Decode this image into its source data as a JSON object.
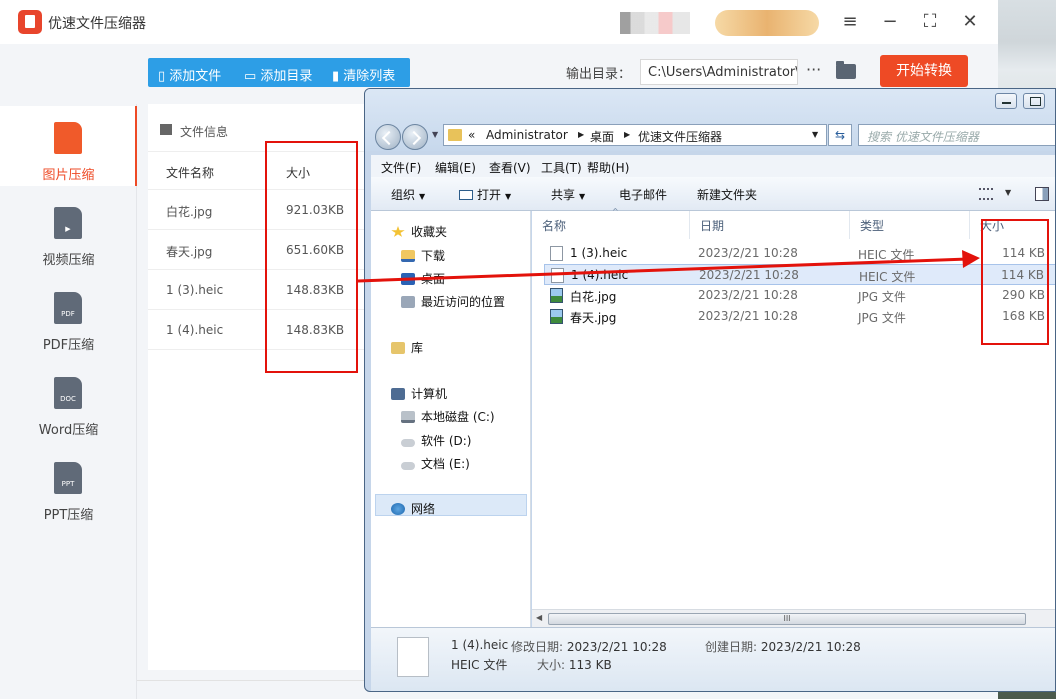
{
  "app": {
    "title": "优速文件压缩器",
    "toolbar": {
      "add_file": "添加文件",
      "add_dir": "添加目录",
      "clear_list": "清除列表"
    },
    "output": {
      "label": "输出目录：",
      "path": "C:\\Users\\Administrator\\",
      "more": "···",
      "start": "开始转换"
    },
    "sidebar": [
      {
        "label": "图片压缩",
        "icon": "image-file-icon",
        "badge": "",
        "active": true
      },
      {
        "label": "视频压缩",
        "icon": "video-file-icon",
        "badge": "▶",
        "active": false
      },
      {
        "label": "PDF压缩",
        "icon": "pdf-file-icon",
        "badge": "PDF",
        "active": false
      },
      {
        "label": "Word压缩",
        "icon": "doc-file-icon",
        "badge": "DOC",
        "active": false
      },
      {
        "label": "PPT压缩",
        "icon": "ppt-file-icon",
        "badge": "PPT",
        "active": false
      }
    ],
    "panel": {
      "title": "文件信息",
      "col_name": "文件名称",
      "col_size": "大小",
      "rows": [
        {
          "name": "白花.jpg",
          "size": "921.03KB"
        },
        {
          "name": "春天.jpg",
          "size": "651.60KB"
        },
        {
          "name": "1 (3).heic",
          "size": "148.83KB"
        },
        {
          "name": "1 (4).heic",
          "size": "148.83KB"
        }
      ]
    }
  },
  "explorer": {
    "address": {
      "prefix": "«",
      "parts": [
        "Administrator",
        "桌面",
        "优速文件压缩器"
      ]
    },
    "search_placeholder": "搜索 优速文件压缩器",
    "menu": [
      "文件(F)",
      "编辑(E)",
      "查看(V)",
      "工具(T)",
      "帮助(H)"
    ],
    "commands": {
      "organize": "组织",
      "open": "打开",
      "share": "共享",
      "email": "电子邮件",
      "new_folder": "新建文件夹"
    },
    "nav": {
      "favorites": "收藏夹",
      "downloads": "下载",
      "desktop": "桌面",
      "recent": "最近访问的位置",
      "libraries": "库",
      "computer": "计算机",
      "drive_c": "本地磁盘 (C:)",
      "drive_d": "软件 (D:)",
      "drive_e": "文档 (E:)",
      "network": "网络"
    },
    "columns": {
      "name": "名称",
      "date": "日期",
      "type": "类型",
      "size": "大小"
    },
    "files": [
      {
        "name": "1 (3).heic",
        "date": "2023/2/21 10:28",
        "type": "HEIC 文件",
        "size": "114 KB",
        "icon": "blank-file-icon"
      },
      {
        "name": "1 (4).heic",
        "date": "2023/2/21 10:28",
        "type": "HEIC 文件",
        "size": "114 KB",
        "icon": "blank-file-icon"
      },
      {
        "name": "白花.jpg",
        "date": "2023/2/21 10:28",
        "type": "JPG 文件",
        "size": "290 KB",
        "icon": "image-file-icon"
      },
      {
        "name": "春天.jpg",
        "date": "2023/2/21 10:28",
        "type": "JPG 文件",
        "size": "168 KB",
        "icon": "image-file-icon"
      }
    ],
    "scroll_grip": "III",
    "details": {
      "name": "1 (4).heic",
      "modified_label": "修改日期:",
      "modified": "2023/2/21 10:28",
      "created_label": "创建日期:",
      "created": "2023/2/21 10:28",
      "type": "HEIC 文件",
      "size_label": "大小:",
      "size": "113 KB"
    }
  },
  "colors": {
    "accent": "#ee4a25",
    "toolbar_blue": "#2d9ee6",
    "annotation_red": "#e3120b"
  }
}
